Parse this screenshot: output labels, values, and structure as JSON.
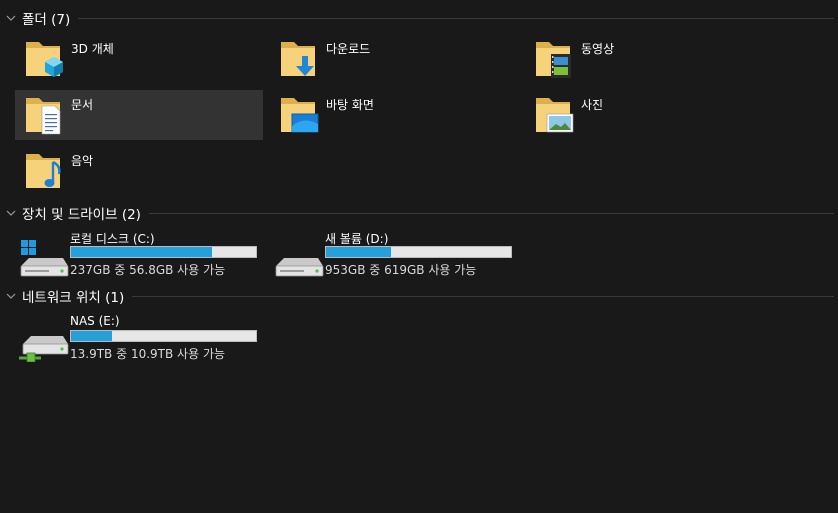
{
  "groups": {
    "folders": {
      "title": "폴더 (7)"
    },
    "devices": {
      "title": "장치 및 드라이브 (2)"
    },
    "network": {
      "title": "네트워크 위치 (1)"
    }
  },
  "folders": [
    {
      "name": "3D 개체",
      "icon": "3d-objects-folder-icon"
    },
    {
      "name": "다운로드",
      "icon": "downloads-folder-icon"
    },
    {
      "name": "동영상",
      "icon": "videos-folder-icon"
    },
    {
      "name": "문서",
      "icon": "documents-folder-icon",
      "selected": true
    },
    {
      "name": "바탕 화면",
      "icon": "desktop-folder-icon"
    },
    {
      "name": "사진",
      "icon": "pictures-folder-icon"
    },
    {
      "name": "음악",
      "icon": "music-folder-icon"
    }
  ],
  "drives": [
    {
      "name": "로컬 디스크 (C:)",
      "usage": "237GB 중 56.8GB 사용 가능",
      "used_fraction": 0.76,
      "icon": "windows-drive-icon"
    },
    {
      "name": "새 볼륨 (D:)",
      "usage": "953GB 중 619GB 사용 가능",
      "used_fraction": 0.35,
      "icon": "hard-drive-icon"
    }
  ],
  "network_drives": [
    {
      "name": "NAS (E:)",
      "usage": "13.9TB 중 10.9TB 사용 가능",
      "used_fraction": 0.22,
      "icon": "network-drive-icon"
    }
  ],
  "colors": {
    "background": "#191919",
    "selected_tile": "#333333",
    "bar_fill": "#26a0da",
    "bar_track": "#e6e6e6"
  }
}
